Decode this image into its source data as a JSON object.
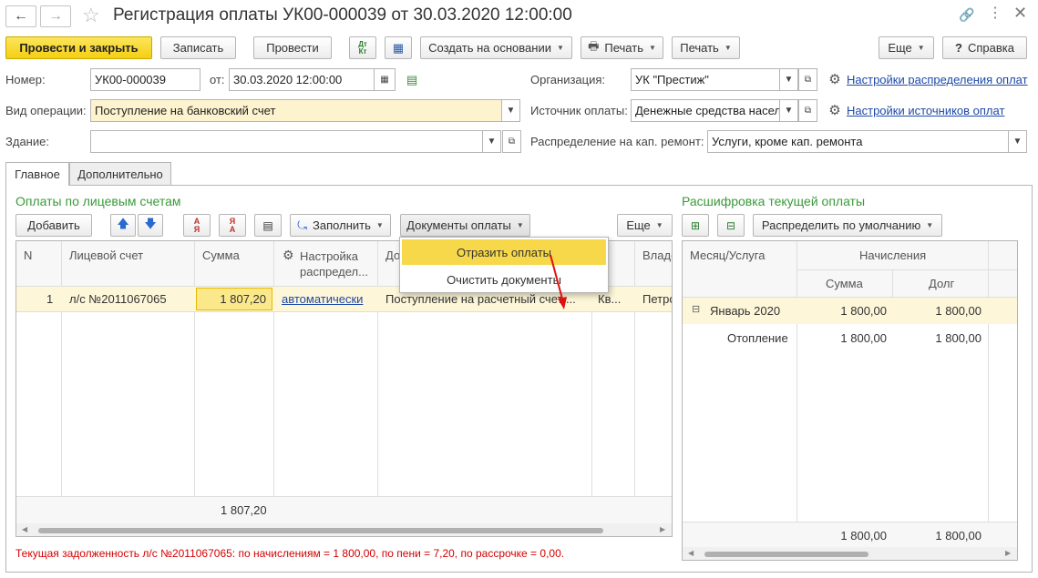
{
  "window": {
    "title": "Регистрация оплаты УК00-000039 от 30.03.2020 12:00:00"
  },
  "toolbar": {
    "post_close": "Провести и закрыть",
    "save": "Записать",
    "post": "Провести",
    "create_based": "Создать на основании",
    "print1": "Печать",
    "print2": "Печать",
    "more": "Еще",
    "help": "Справка"
  },
  "form": {
    "number_label": "Номер:",
    "number_value": "УК00-000039",
    "from_label": "от:",
    "date_value": "30.03.2020 12:00:00",
    "operation_label": "Вид операции:",
    "operation_value": "Поступление на банковский счет",
    "building_label": "Здание:",
    "building_value": "",
    "org_label": "Организация:",
    "org_value": "УК \"Престиж\"",
    "source_label": "Источник оплаты:",
    "source_value": "Денежные средства насел",
    "distribution_label": "Распределение на кап. ремонт:",
    "distribution_value": "Услуги, кроме кап. ремонта",
    "settings_distribution_link": "Настройки распределения оплат",
    "settings_sources_link": "Настройки источников оплат"
  },
  "tabs": [
    {
      "label": "Главное"
    },
    {
      "label": "Дополнительно"
    }
  ],
  "left_panel": {
    "title": "Оплаты по лицевым счетам",
    "add": "Добавить",
    "fill": "Заполнить",
    "payment_docs": "Документы оплаты",
    "more": "Еще",
    "columns": [
      "N",
      "Лицевой счет",
      "Сумма",
      "Настройка распредел...",
      "До",
      "",
      "Владе"
    ],
    "rows": [
      {
        "n": "1",
        "account": "л/с №2011067065",
        "sum": "1 807,20",
        "setting": "автоматически",
        "doc": "Поступление на расчетный счет ...",
        "col6": "Кв...",
        "owner": "Петро"
      }
    ],
    "total_sum": "1 807,20"
  },
  "dropdown_menu": {
    "items": [
      "Отразить оплаты",
      "Очистить документы"
    ]
  },
  "right_panel": {
    "title": "Расшифровка текущей оплаты",
    "distribute": "Распределить по умолчанию",
    "col_month": "Месяц/Услуга",
    "col_charges": "Начисления",
    "col_sum": "Сумма",
    "col_debt": "Долг",
    "rows": [
      {
        "name": "Январь 2020",
        "sum": "1 800,00",
        "debt": "1 800,00"
      },
      {
        "name": "Отопление",
        "sum": "1 800,00",
        "debt": "1 800,00"
      }
    ],
    "total_sum": "1 800,00",
    "total_debt": "1 800,00"
  },
  "status": {
    "text": "Текущая задолженность л/с №2011067065: по начислениям = 1 800,00, по пени = 7,20, по рассрочке = 0,00."
  },
  "colors": {
    "accent_yellow": "#f5cf12",
    "row_highlight": "#fdf6d8",
    "link_blue": "#1e49a7",
    "section_green": "#3a9a3a",
    "status_red": "#d40000"
  }
}
